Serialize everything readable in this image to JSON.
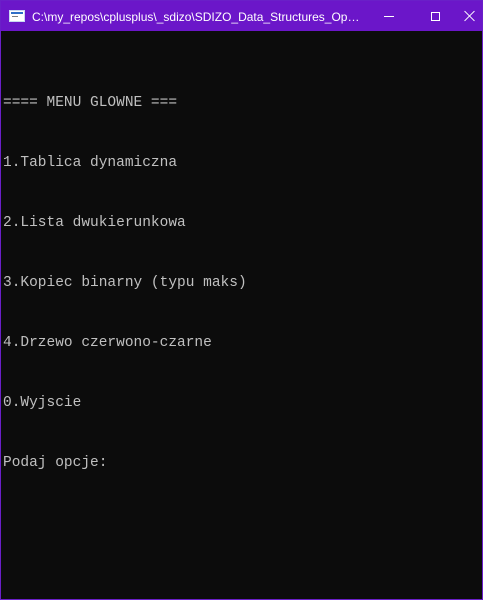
{
  "window": {
    "title": "C:\\my_repos\\cplusplus\\_sdizo\\SDIZO_Data_Structures_Opera...",
    "accent_color": "#6b16c9",
    "background_color": "#0c0c0c",
    "text_color": "#c0c0c0"
  },
  "titlebar": {
    "app_icon": "console-window-icon",
    "minimize_icon": "minimize-icon",
    "maximize_icon": "maximize-icon",
    "close_icon": "close-icon"
  },
  "console": {
    "lines": [
      "==== MENU GLOWNE ===",
      "1.Tablica dynamiczna",
      "2.Lista dwukierunkowa",
      "3.Kopiec binarny (typu maks)",
      "4.Drzewo czerwono-czarne",
      "0.Wyjscie",
      "Podaj opcje:"
    ]
  }
}
